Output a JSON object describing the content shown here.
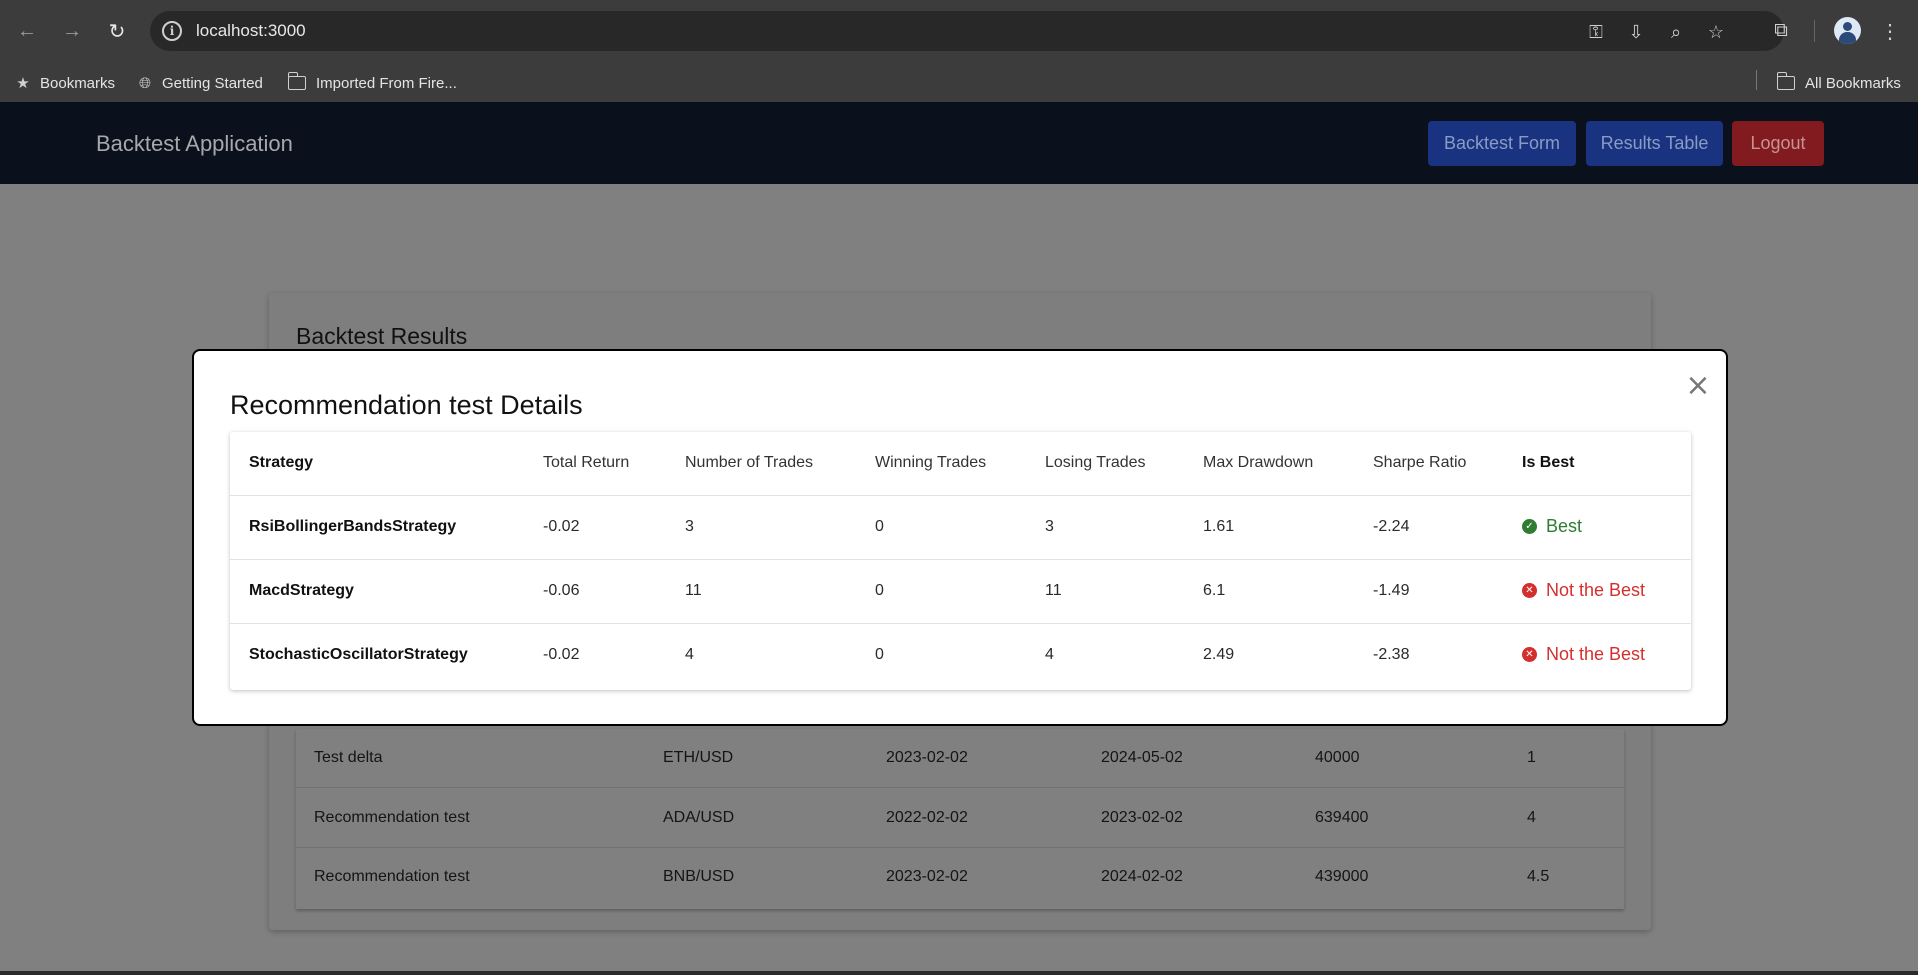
{
  "browser": {
    "url": "localhost:3000",
    "bookmarks": [
      "Bookmarks",
      "Getting Started",
      "Imported From Fire..."
    ],
    "all_bookmarks": "All Bookmarks"
  },
  "app": {
    "title": "Backtest Application",
    "nav": {
      "backtest_form": "Backtest Form",
      "results_table": "Results Table",
      "logout": "Logout"
    }
  },
  "results": {
    "title": "Backtest Results",
    "rows": [
      [
        "Test delta",
        "ETH/USD",
        "2023-02-02",
        "2024-05-02",
        "40000",
        "1"
      ],
      [
        "Recommendation test",
        "ADA/USD",
        "2022-02-02",
        "2023-02-02",
        "639400",
        "4"
      ],
      [
        "Recommendation test",
        "BNB/USD",
        "2023-02-02",
        "2024-02-02",
        "439000",
        "4.5"
      ]
    ]
  },
  "modal": {
    "title": "Recommendation test Details",
    "close": "×",
    "headers": [
      "Strategy",
      "Total Return",
      "Number of Trades",
      "Winning Trades",
      "Losing Trades",
      "Max Drawdown",
      "Sharpe Ratio",
      "Is Best"
    ],
    "rows": [
      {
        "strategy": "RsiBollingerBandsStrategy",
        "total_return": "-0.02",
        "trades": "3",
        "winning": "0",
        "losing": "3",
        "max_drawdown": "1.61",
        "sharpe": "-2.24",
        "is_best": "Best",
        "best": true
      },
      {
        "strategy": "MacdStrategy",
        "total_return": "-0.06",
        "trades": "11",
        "winning": "0",
        "losing": "11",
        "max_drawdown": "6.1",
        "sharpe": "-1.49",
        "is_best": "Not the Best",
        "best": false
      },
      {
        "strategy": "StochasticOscillatorStrategy",
        "total_return": "-0.02",
        "trades": "4",
        "winning": "0",
        "losing": "4",
        "max_drawdown": "2.49",
        "sharpe": "-2.38",
        "is_best": "Not the Best",
        "best": false
      }
    ]
  },
  "colors": {
    "best": "#2e7d32",
    "not_best": "#d32f2f",
    "nav_bg": "#0b111c",
    "btn_blue": "#193380",
    "btn_red": "#821b20"
  }
}
